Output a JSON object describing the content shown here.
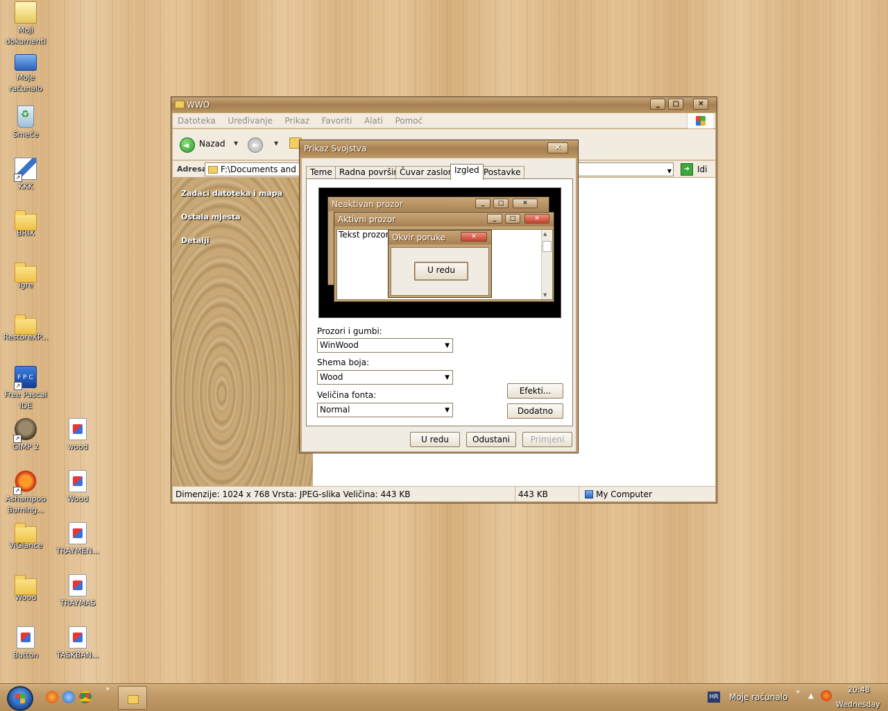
{
  "desktop": {
    "icons": [
      {
        "label": "Moji\ndokumenti",
        "icon": "documents-icon"
      },
      {
        "label": "Moje\nračunalo",
        "icon": "computer-icon"
      },
      {
        "label": "Smeće",
        "icon": "recycle-bin-icon"
      },
      {
        "label": "KKK",
        "icon": "app-icon"
      },
      {
        "label": "BRIX",
        "icon": "folder-icon"
      },
      {
        "label": "Igre",
        "icon": "folder-icon"
      },
      {
        "label": "RestoreXP...",
        "icon": "folder-icon"
      },
      {
        "label": "Free Pascal\nIDE",
        "icon": "fpc-icon"
      },
      {
        "label": "GIMP 2",
        "icon": "gimp-icon"
      },
      {
        "label": "Ashampoo\nBurning...",
        "icon": "ashampoo-icon"
      },
      {
        "label": "ViGlance",
        "icon": "folder-icon"
      },
      {
        "label": "Wood",
        "icon": "folder-icon"
      },
      {
        "label": "Button",
        "icon": "image-file-icon"
      },
      {
        "label": "wood",
        "icon": "image-file-icon"
      },
      {
        "label": "Wood",
        "icon": "image-file-icon"
      },
      {
        "label": "TRAYMEN...",
        "icon": "image-file-icon"
      },
      {
        "label": "TRAYMAS",
        "icon": "image-file-icon"
      },
      {
        "label": "TASKBAN...",
        "icon": "image-file-icon"
      }
    ]
  },
  "explorer": {
    "title": "WWO",
    "menu": [
      "Datoteka",
      "Uređivanje",
      "Prikaz",
      "Favoriti",
      "Alati",
      "Pomoć"
    ],
    "back_label": "Nazad",
    "address_label": "Adresa",
    "address_value": "F:\\Documents and Se",
    "go_label": "Idi",
    "task_groups": [
      "Zadaci datoteka i mapa",
      "Ostala mjesta",
      "Detalji"
    ],
    "status": {
      "info": "Dimenzije: 1024 x 768 Vrsta: JPEG-slika Veličina: 443 KB",
      "size": "443 KB",
      "zone": "My Computer"
    }
  },
  "dialog": {
    "title": "Prikaz Svojstva",
    "tabs": [
      "Teme",
      "Radna površina",
      "Čuvar zaslona",
      "Izgled",
      "Postavke"
    ],
    "active_tab": "Izgled",
    "preview": {
      "inactive_title": "Neaktivan prozor",
      "active_title": "Aktivni prozor",
      "window_text": "Tekst prozora",
      "msgbox_title": "Okvir poruke",
      "ok_label": "U redu"
    },
    "windows_buttons_label": "Prozori i gumbi:",
    "windows_buttons_value": "WinWood",
    "color_scheme_label": "Shema boja:",
    "color_scheme_value": "Wood",
    "font_size_label": "Veličina fonta:",
    "font_size_value": "Normal",
    "effects_label": "Efekti...",
    "advanced_label": "Dodatno",
    "ok_label": "U redu",
    "cancel_label": "Odustani",
    "apply_label": "Primjeni"
  },
  "taskbar": {
    "tray_lang": "HR",
    "tray_text": "Moje računalo",
    "clock_time": "20:48",
    "clock_day": "Wednesday",
    "more": "»"
  }
}
